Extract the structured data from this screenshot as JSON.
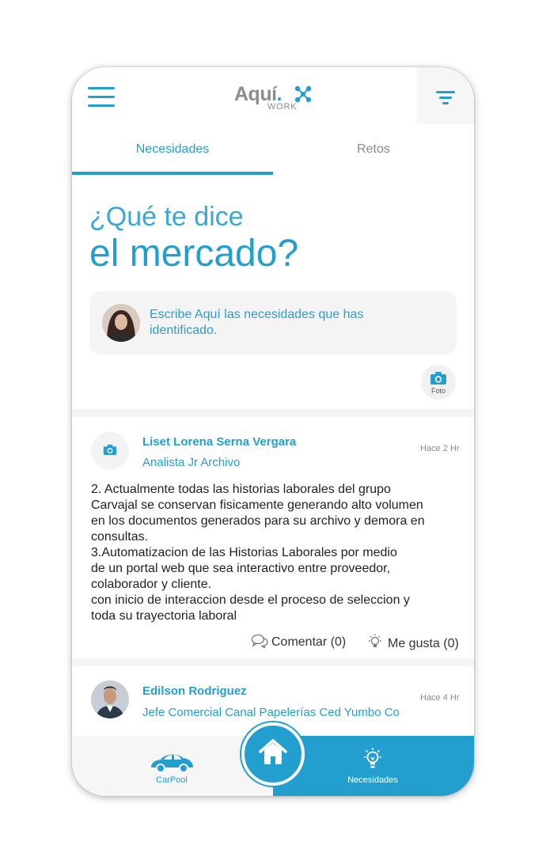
{
  "header": {
    "logo_word": "Aquí",
    "logo_dot": ".",
    "logo_sub": "WORK"
  },
  "tabs": [
    {
      "label": "Necesidades",
      "active": true
    },
    {
      "label": "Retos",
      "active": false
    }
  ],
  "hero": {
    "line1": "¿Qué te dice",
    "line2": "el mercado?"
  },
  "compose": {
    "placeholder": "Escribe Aquí las necesidades que has identificado."
  },
  "photo_button": {
    "label": "Foto",
    "icon": "camera-icon"
  },
  "posts": [
    {
      "author": "Liset  Lorena Serna  Vergara",
      "role": "Analista Jr Archivo",
      "time": "Hace 2 Hr",
      "body": [
        "2. Actualmente todas las historias laborales del grupo",
        "Carvajal se conservan fisicamente generando alto volumen",
        "en los documentos generados para su archivo y demora en",
        "consultas.",
        "3.Automatizacion de las Historias Laborales por medio",
        "de un portal web que sea interactivo entre proveedor,",
        "colaborador y cliente.",
        "con inicio de interaccion desde el proceso de seleccion y",
        "toda su trayectoria laboral"
      ],
      "comment_label": "Comentar (0)",
      "like_label": "Me gusta (0)"
    },
    {
      "author": "Edilson Rodriguez",
      "role": "Jefe Comercial Canal Papelerías Ced Yumbo Co",
      "time": "Hace 4 Hr"
    }
  ],
  "bottom_nav": {
    "left_label": "CarPool",
    "right_label": "Necesidades",
    "left_icon": "car-icon",
    "center_icon": "home-icon",
    "right_icon": "lightbulb-icon"
  },
  "colors": {
    "accent": "#239fcf",
    "muted": "#8a8a8a",
    "surface": "#f4f4f4"
  }
}
